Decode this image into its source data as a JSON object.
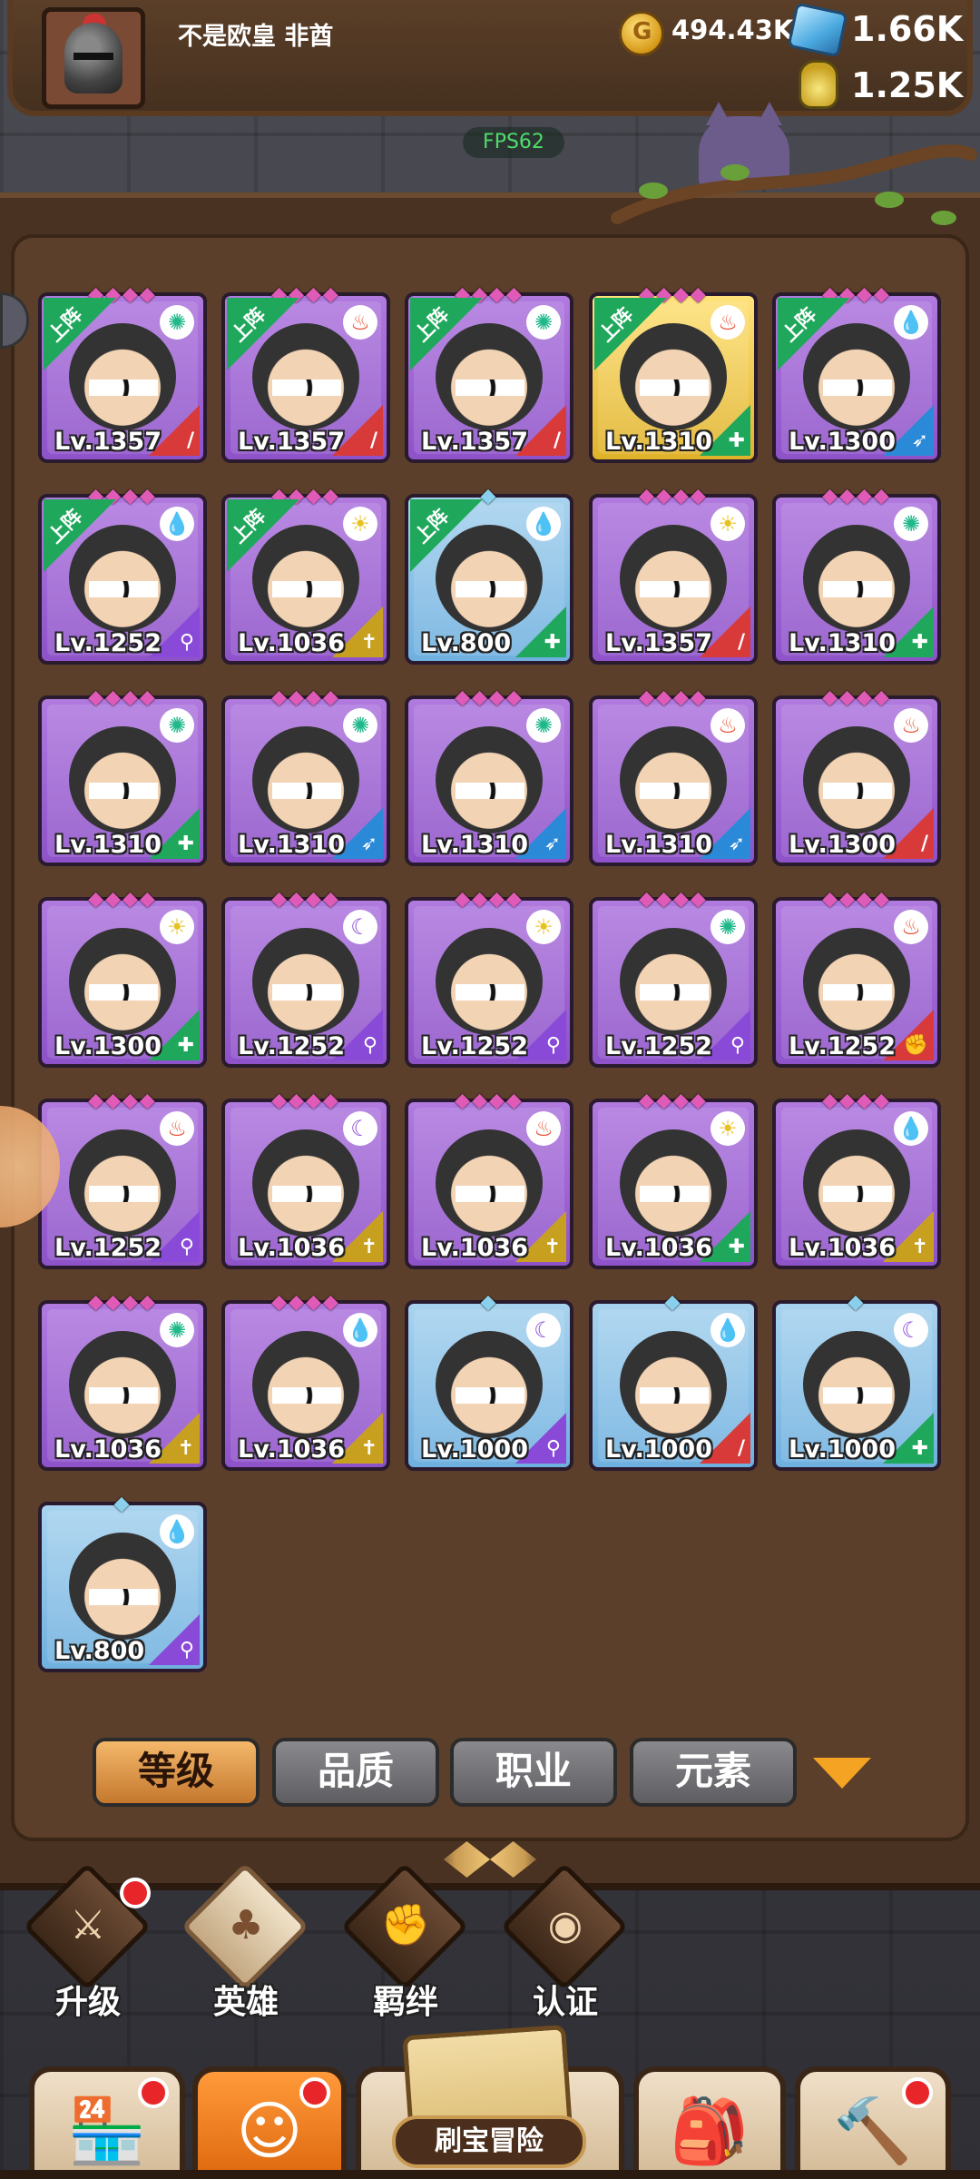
{
  "player": {
    "name": "不是欧皇 非酋"
  },
  "resources": {
    "gold": "494.43K",
    "gems": "1.66K",
    "potion": "1.25K"
  },
  "fps": "FPS62",
  "deployed_label": "上阵",
  "heroes": [
    {
      "level": "Lv.1357",
      "rarity": "purple",
      "deployed": true,
      "element": "wind",
      "role": "sword",
      "stars": "◆◆◆◆"
    },
    {
      "level": "Lv.1357",
      "rarity": "purple",
      "deployed": true,
      "element": "fire",
      "role": "sword",
      "stars": "◆◆◆◆"
    },
    {
      "level": "Lv.1357",
      "rarity": "purple",
      "deployed": true,
      "element": "wind",
      "role": "sword",
      "stars": "◆◆◆◆"
    },
    {
      "level": "Lv.1310",
      "rarity": "gold",
      "deployed": true,
      "element": "fire",
      "role": "shield",
      "stars": "◆◆◆◆"
    },
    {
      "level": "Lv.1300",
      "rarity": "purple",
      "deployed": true,
      "element": "water",
      "role": "bow",
      "stars": "◆◆◆◆"
    },
    {
      "level": "Lv.1252",
      "rarity": "purple",
      "deployed": true,
      "element": "water",
      "role": "staff",
      "stars": "◆◆◆◆"
    },
    {
      "level": "Lv.1036",
      "rarity": "purple",
      "deployed": true,
      "element": "light",
      "role": "holy",
      "stars": "◆◆◆◆"
    },
    {
      "level": "Lv.800",
      "rarity": "blue",
      "deployed": true,
      "element": "water",
      "role": "shield",
      "stars": "◆"
    },
    {
      "level": "Lv.1357",
      "rarity": "purple",
      "deployed": false,
      "element": "light",
      "role": "sword",
      "stars": "◆◆◆◆"
    },
    {
      "level": "Lv.1310",
      "rarity": "purple",
      "deployed": false,
      "element": "wind",
      "role": "shield",
      "stars": "◆◆◆◆"
    },
    {
      "level": "Lv.1310",
      "rarity": "purple",
      "deployed": false,
      "element": "wind",
      "role": "shield",
      "stars": "◆◆◆◆"
    },
    {
      "level": "Lv.1310",
      "rarity": "purple",
      "deployed": false,
      "element": "wind",
      "role": "bow",
      "stars": "◆◆◆◆"
    },
    {
      "level": "Lv.1310",
      "rarity": "purple",
      "deployed": false,
      "element": "wind",
      "role": "bow",
      "stars": "◆◆◆◆"
    },
    {
      "level": "Lv.1310",
      "rarity": "purple",
      "deployed": false,
      "element": "fire",
      "role": "bow",
      "stars": "◆◆◆◆"
    },
    {
      "level": "Lv.1300",
      "rarity": "purple",
      "deployed": false,
      "element": "fire",
      "role": "sword",
      "stars": "◆◆◆◆"
    },
    {
      "level": "Lv.1300",
      "rarity": "purple",
      "deployed": false,
      "element": "light",
      "role": "shield",
      "stars": "◆◆◆◆"
    },
    {
      "level": "Lv.1252",
      "rarity": "purple",
      "deployed": false,
      "element": "dark",
      "role": "staff",
      "stars": "◆◆◆◆"
    },
    {
      "level": "Lv.1252",
      "rarity": "purple",
      "deployed": false,
      "element": "light",
      "role": "staff",
      "stars": "◆◆◆◆"
    },
    {
      "level": "Lv.1252",
      "rarity": "purple",
      "deployed": false,
      "element": "wind",
      "role": "staff",
      "stars": "◆◆◆◆"
    },
    {
      "level": "Lv.1252",
      "rarity": "purple",
      "deployed": false,
      "element": "fire",
      "role": "fist",
      "stars": "◆◆◆◆"
    },
    {
      "level": "Lv.1252",
      "rarity": "purple",
      "deployed": false,
      "element": "fire",
      "role": "staff",
      "stars": "◆◆◆◆"
    },
    {
      "level": "Lv.1036",
      "rarity": "purple",
      "deployed": false,
      "element": "dark",
      "role": "holy",
      "stars": "◆◆◆◆"
    },
    {
      "level": "Lv.1036",
      "rarity": "purple",
      "deployed": false,
      "element": "fire",
      "role": "holy",
      "stars": "◆◆◆◆"
    },
    {
      "level": "Lv.1036",
      "rarity": "purple",
      "deployed": false,
      "element": "light",
      "role": "shield",
      "stars": "◆◆◆◆"
    },
    {
      "level": "Lv.1036",
      "rarity": "purple",
      "deployed": false,
      "element": "water",
      "role": "holy",
      "stars": "◆◆◆◆"
    },
    {
      "level": "Lv.1036",
      "rarity": "purple",
      "deployed": false,
      "element": "wind",
      "role": "holy",
      "stars": "◆◆◆◆"
    },
    {
      "level": "Lv.1036",
      "rarity": "purple",
      "deployed": false,
      "element": "water",
      "role": "holy",
      "stars": "◆◆◆◆"
    },
    {
      "level": "Lv.1000",
      "rarity": "blue",
      "deployed": false,
      "element": "dark",
      "role": "staff",
      "stars": "◆"
    },
    {
      "level": "Lv.1000",
      "rarity": "blue",
      "deployed": false,
      "element": "water",
      "role": "sword",
      "stars": "◆"
    },
    {
      "level": "Lv.1000",
      "rarity": "blue",
      "deployed": false,
      "element": "dark",
      "role": "shield",
      "stars": "◆"
    },
    {
      "level": "Lv.800",
      "rarity": "blue",
      "deployed": false,
      "element": "water",
      "role": "staff",
      "stars": "◆"
    }
  ],
  "filters": {
    "level": "等级",
    "quality": "品质",
    "class": "职业",
    "element": "元素"
  },
  "sub_menu": {
    "upgrade": "升级",
    "heroes": "英雄",
    "bonds": "羁绊",
    "certify": "认证"
  },
  "adventure_label": "刷宝冒险",
  "colors": {
    "fire": "#e8462a",
    "water": "#2a7ce8",
    "wind": "#20b88a",
    "light": "#e8c020",
    "dark": "#8a4ad8",
    "sword": "#d83a3a",
    "shield": "#1fa85c",
    "bow": "#2a8ad8",
    "staff": "#8a4ad8",
    "holy": "#c8a020",
    "fist": "#d83a3a"
  }
}
